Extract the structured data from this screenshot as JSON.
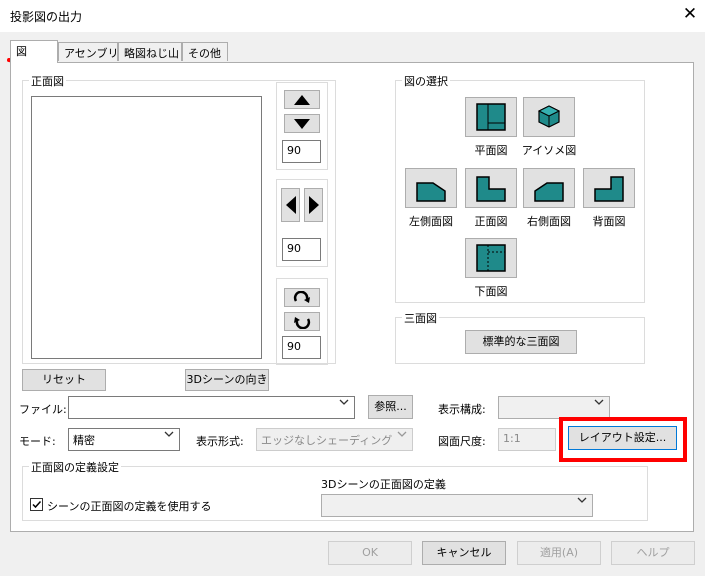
{
  "window": {
    "title": "投影図の出力",
    "close_glyph": "✕"
  },
  "tabs": [
    {
      "label": "図"
    },
    {
      "label": "アセンブリ"
    },
    {
      "label": "略図ねじ山"
    },
    {
      "label": "その他"
    }
  ],
  "front_view": {
    "group_title": "正面図",
    "rotate_x_value": "90",
    "rotate_y_value": "90",
    "rotate_z_value": "90",
    "reset_label": "リセット",
    "scene_direction_label": "3Dシーンの向き"
  },
  "view_selection": {
    "group_title": "図の選択",
    "views": [
      {
        "label": "平面図"
      },
      {
        "label": "アイソメ図"
      },
      {
        "label": "左側面図"
      },
      {
        "label": "正面図"
      },
      {
        "label": "右側面図"
      },
      {
        "label": "背面図"
      },
      {
        "label": "下面図"
      }
    ]
  },
  "three_views": {
    "group_title": "三面図",
    "button_label": "標準的な三面図"
  },
  "file": {
    "label": "ファイル:",
    "value": "",
    "browse_label": "参照..."
  },
  "display_config": {
    "label": "表示構成:",
    "value": ""
  },
  "mode": {
    "label": "モード:",
    "value": "精密"
  },
  "display_format": {
    "label": "表示形式:",
    "value": "エッジなしシェーディング"
  },
  "drawing_scale": {
    "label": "図面尺度:",
    "value": "1:1"
  },
  "layout_settings_label": "レイアウト設定...",
  "front_definition": {
    "group_title": "正面図の定義設定",
    "checkbox_label": "シーンの正面図の定義を使用する",
    "checked": true,
    "scene_front_label": "3Dシーンの正面図の定義",
    "scene_front_value": ""
  },
  "footer": {
    "ok": "OK",
    "cancel": "キャンセル",
    "apply": "適用(A)",
    "help": "ヘルプ"
  },
  "colors": {
    "accent_teal": "#1f8a8a",
    "highlight_red": "#ff0000"
  }
}
